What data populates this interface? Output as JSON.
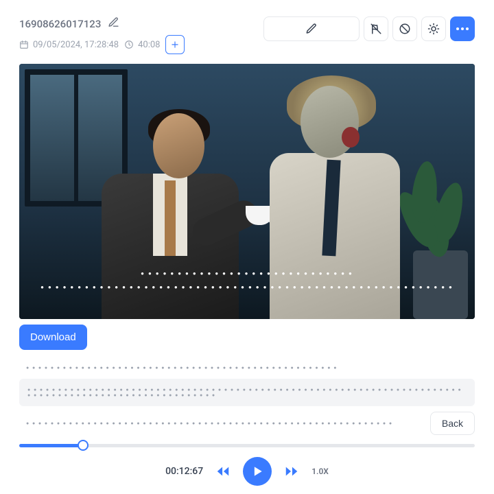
{
  "header": {
    "title": "16908626017123",
    "datetime": "09/05/2024, 17:28:48",
    "duration": "40:08"
  },
  "actions": {
    "download_label": "Download",
    "back_label": "Back"
  },
  "player": {
    "current_time": "00:12:67",
    "speed": "1.0X",
    "progress_percent": 14
  },
  "colors": {
    "primary": "#3a7bff"
  }
}
